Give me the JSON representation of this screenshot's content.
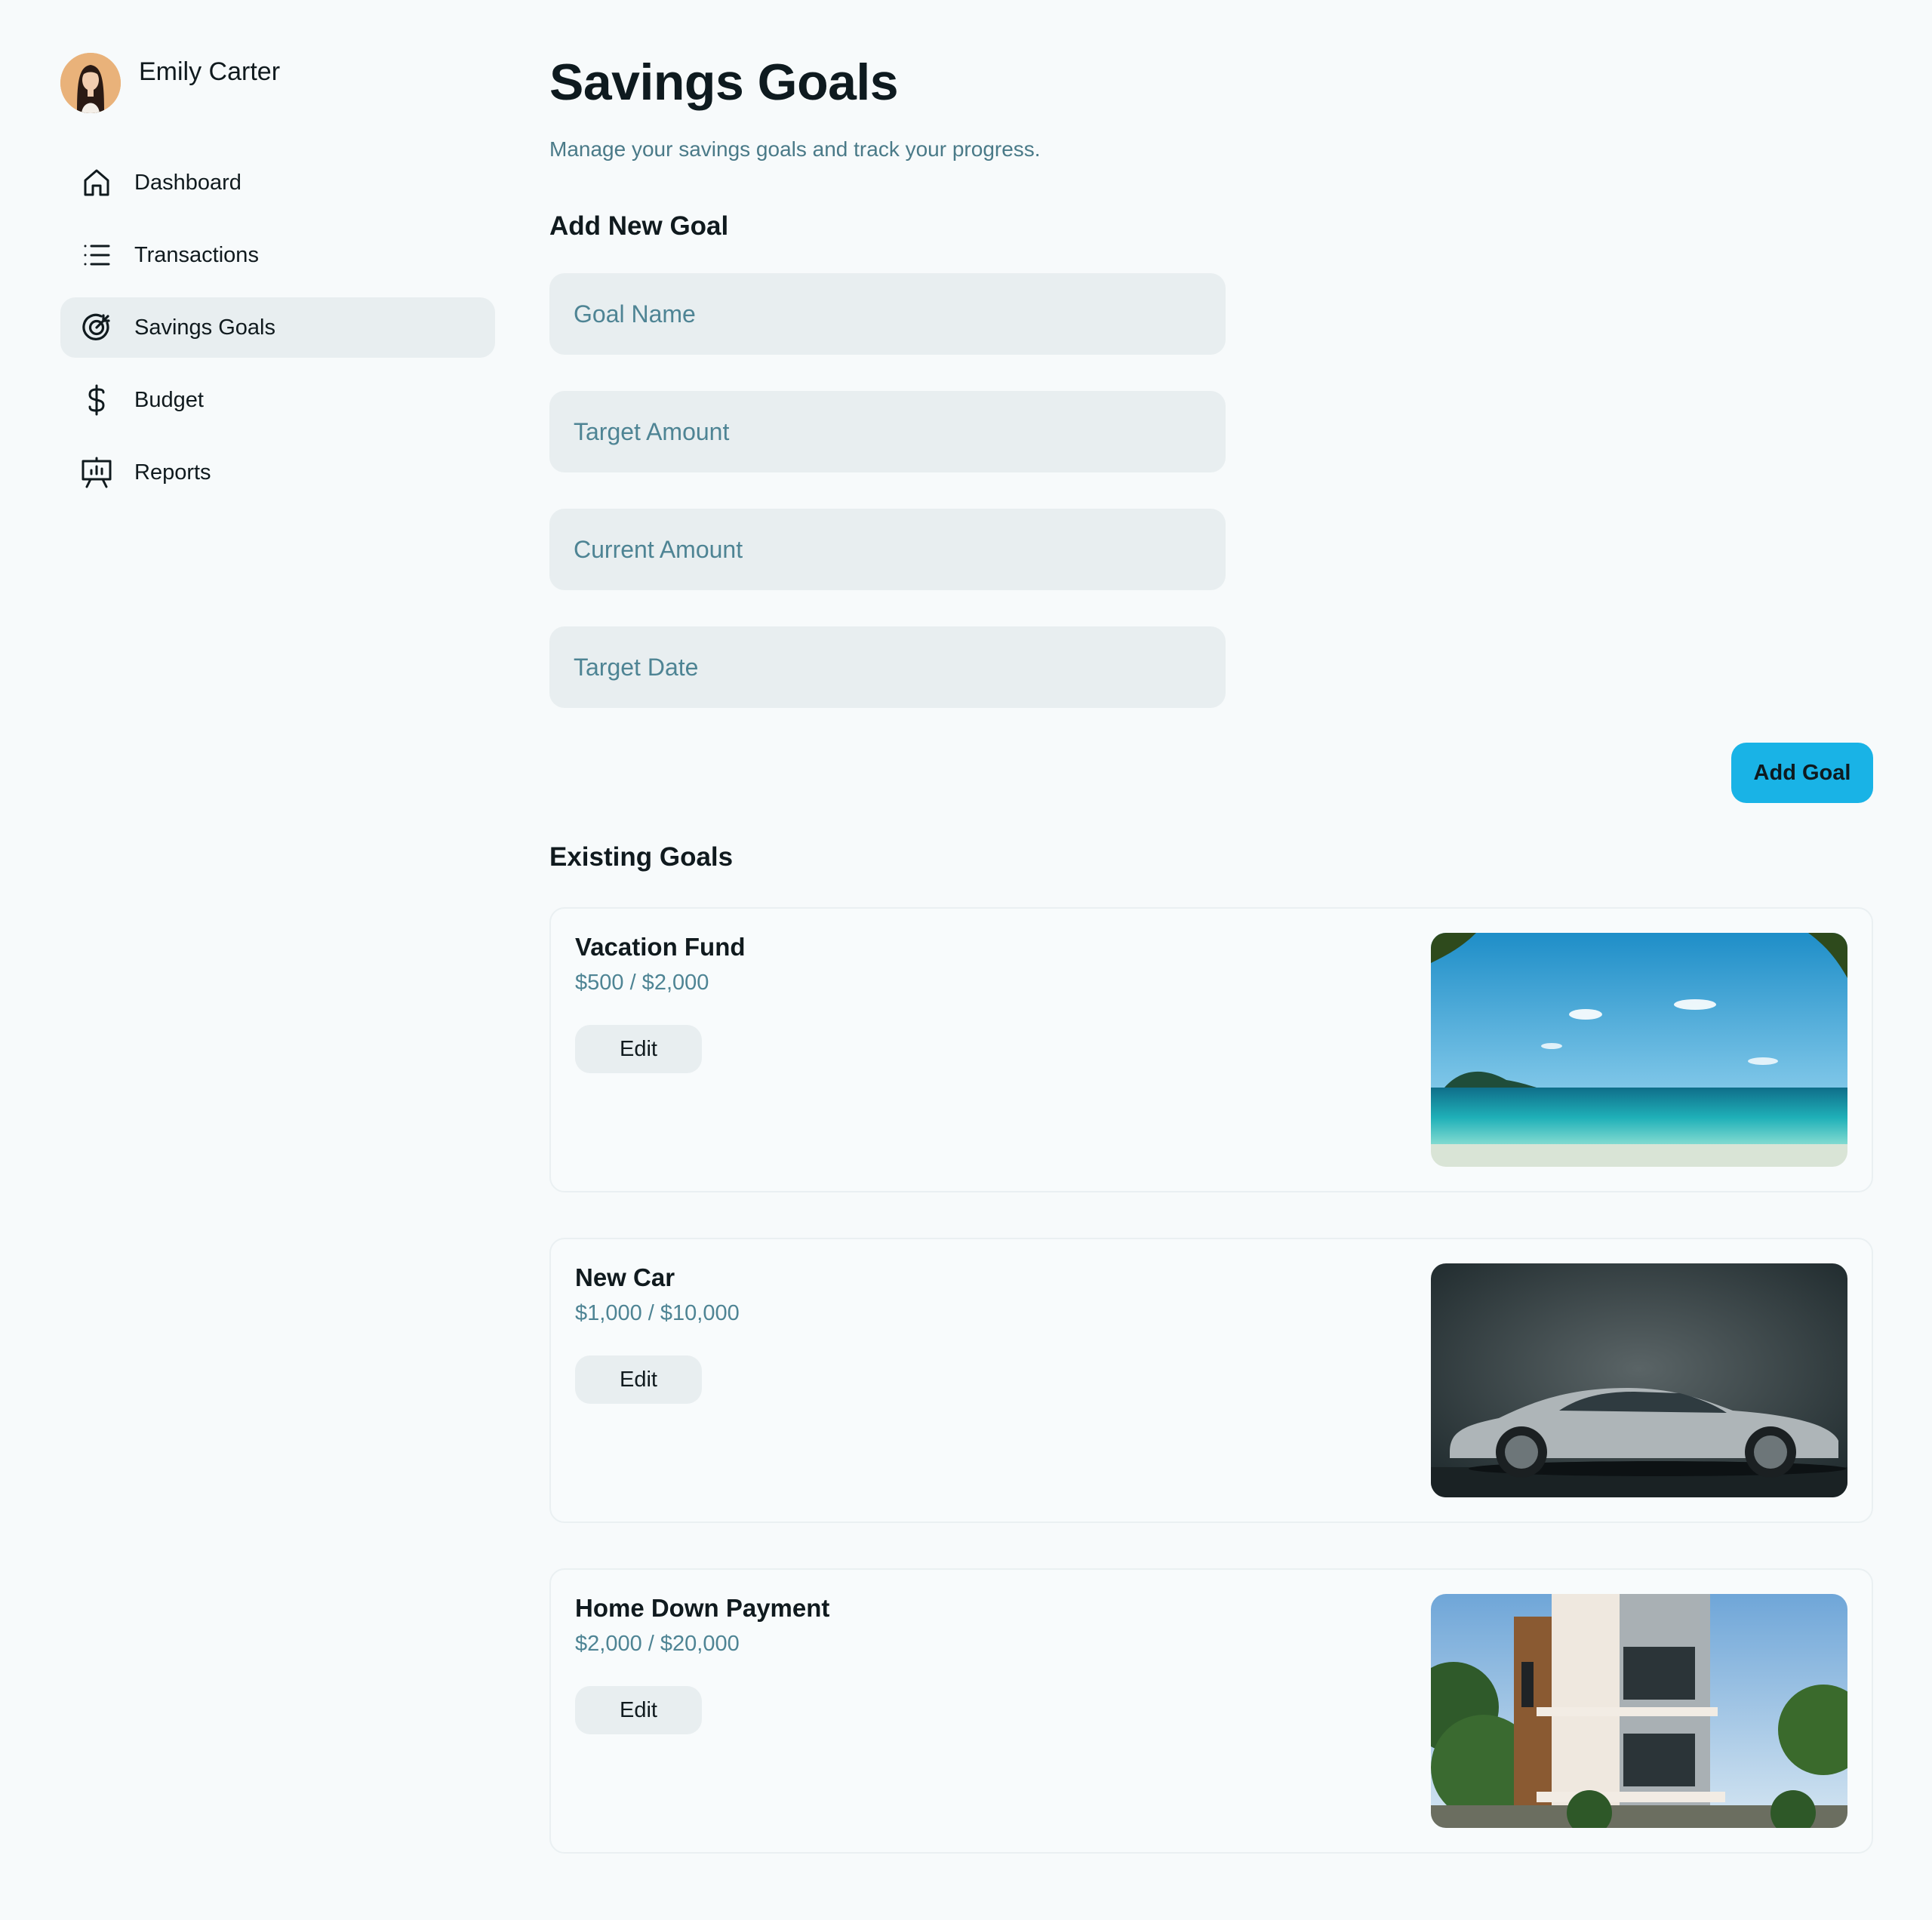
{
  "user": {
    "name": "Emily Carter"
  },
  "sidebar": {
    "items": [
      {
        "label": "Dashboard",
        "icon": "home-icon"
      },
      {
        "label": "Transactions",
        "icon": "list-icon"
      },
      {
        "label": "Savings Goals",
        "icon": "target-icon",
        "active": true
      },
      {
        "label": "Budget",
        "icon": "dollar-icon"
      },
      {
        "label": "Reports",
        "icon": "presentation-chart-icon"
      }
    ]
  },
  "page": {
    "title": "Savings Goals",
    "subtitle": "Manage your savings goals and track your progress."
  },
  "add_goal": {
    "title": "Add New Goal",
    "fields": {
      "goal_name": {
        "placeholder": "Goal Name",
        "value": ""
      },
      "target_amount": {
        "placeholder": "Target Amount",
        "value": ""
      },
      "current_amount": {
        "placeholder": "Current Amount",
        "value": ""
      },
      "target_date": {
        "placeholder": "Target Date",
        "value": ""
      }
    },
    "button_label": "Add Goal"
  },
  "existing_goals": {
    "title": "Existing Goals",
    "items": [
      {
        "name": "Vacation Fund",
        "amount": "$500 / $2,000",
        "edit_label": "Edit",
        "image": "beach-image"
      },
      {
        "name": "New Car",
        "amount": "$1,000 / $10,000",
        "edit_label": "Edit",
        "image": "car-image"
      },
      {
        "name": "Home Down Payment",
        "amount": "$2,000 / $20,000",
        "edit_label": "Edit",
        "image": "house-image"
      }
    ]
  },
  "colors": {
    "accent": "#19b3e6",
    "background": "#f7fafb",
    "input_bg": "#e8eef0",
    "muted_text": "#4e8494"
  }
}
